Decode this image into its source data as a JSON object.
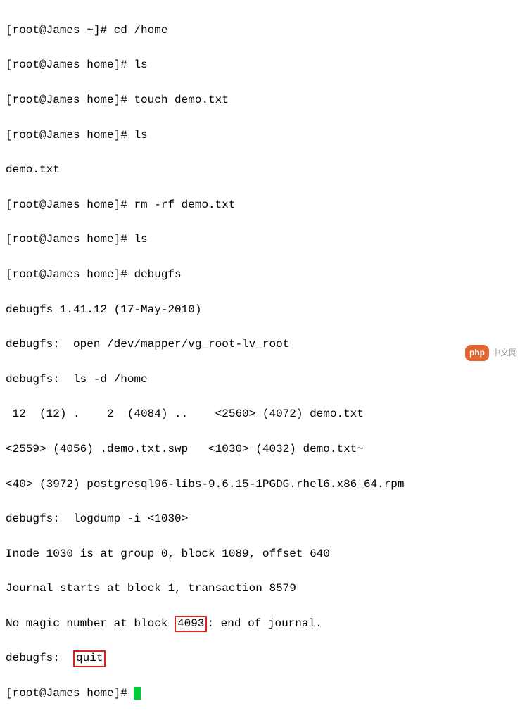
{
  "lines": {
    "l0_prompt": "[root@James ~]# ",
    "l0_cmd": "cd /home",
    "l1_prompt": "[root@James home]# ",
    "l1_cmd": "ls",
    "l2_prompt": "[root@James home]# ",
    "l2_cmd": "touch demo.txt",
    "l3_prompt": "[root@James home]# ",
    "l3_cmd": "ls",
    "l4_out": "demo.txt",
    "l5_prompt": "[root@James home]# ",
    "l5_cmd": "rm -rf demo.txt",
    "l6_prompt": "[root@James home]# ",
    "l6_cmd": "ls",
    "l7_prompt": "[root@James home]# ",
    "l7_cmd": "debugfs",
    "l8_out": "debugfs 1.41.12 (17-May-2010)",
    "l9_out": "debugfs:  open /dev/mapper/vg_root-lv_root",
    "l10_out": "debugfs:  ls -d /home",
    "l11_out": " 12  (12) .    2  (4084) ..    <2560> (4072) demo.txt   ",
    "l12_out": "<2559> (4056) .demo.txt.swp   <1030> (4032) demo.txt~   ",
    "l13_out": "<40> (3972) postgresql96-libs-9.6.15-1PGDG.rhel6.x86_64.rpm   ",
    "l14_out": "debugfs:  logdump -i <1030>",
    "l15_out": "Inode 1030 is at group 0, block 1089, offset 640",
    "l16_out": "Journal starts at block 1, transaction 8579",
    "l17_a": "No magic number at block ",
    "l17_box": "4093",
    "l17_b": ": end of journal.",
    "l18_a": "debugfs:  ",
    "l18_box": "quit",
    "l19_prompt": "[root@James home]# "
  },
  "watermark": {
    "pill": "php",
    "text": "中文网"
  }
}
